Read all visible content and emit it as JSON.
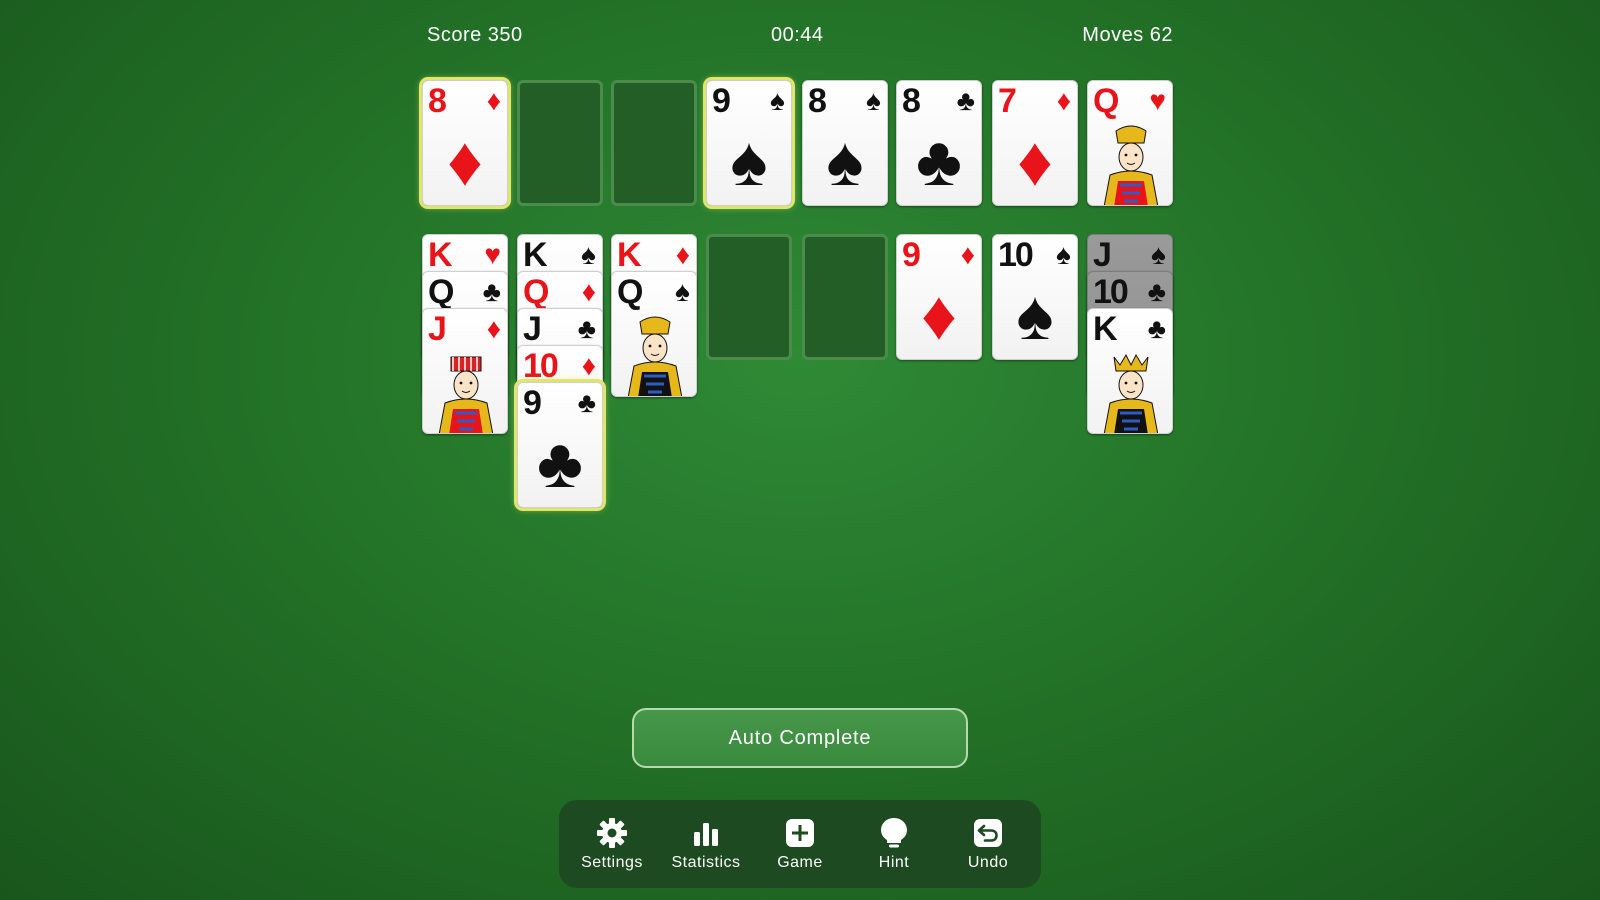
{
  "hud": {
    "score": "Score  350",
    "time": "00:44",
    "moves": "Moves  62"
  },
  "colors": {
    "felt": "#237328",
    "red_suit": "#e8141a",
    "black_suit": "#111111",
    "highlight": "#e1e66a"
  },
  "top_row": [
    {
      "rank": "8",
      "suit": "♦",
      "color": "red",
      "selected": true
    },
    {
      "empty": true
    },
    {
      "empty": true
    },
    {
      "rank": "9",
      "suit": "♠",
      "color": "black",
      "selected": true
    },
    {
      "rank": "8",
      "suit": "♠",
      "color": "black"
    },
    {
      "rank": "8",
      "suit": "♣",
      "color": "black"
    },
    {
      "rank": "7",
      "suit": "♦",
      "color": "red"
    },
    {
      "rank": "Q",
      "suit": "♥",
      "color": "red",
      "face": "queen"
    }
  ],
  "tableau": [
    [
      {
        "rank": "K",
        "suit": "♥",
        "color": "red"
      },
      {
        "rank": "Q",
        "suit": "♣",
        "color": "black"
      },
      {
        "rank": "J",
        "suit": "♦",
        "color": "red",
        "face": "jack"
      }
    ],
    [
      {
        "rank": "K",
        "suit": "♠",
        "color": "black"
      },
      {
        "rank": "Q",
        "suit": "♦",
        "color": "red"
      },
      {
        "rank": "J",
        "suit": "♣",
        "color": "black"
      },
      {
        "rank": "10",
        "suit": "♦",
        "color": "red"
      },
      {
        "rank": "9",
        "suit": "♣",
        "color": "black",
        "selected": true
      }
    ],
    [
      {
        "rank": "K",
        "suit": "♦",
        "color": "red"
      },
      {
        "rank": "Q",
        "suit": "♠",
        "color": "black",
        "face": "queen"
      }
    ],
    [],
    [],
    [
      {
        "rank": "9",
        "suit": "♦",
        "color": "red"
      }
    ],
    [
      {
        "rank": "10",
        "suit": "♠",
        "color": "black"
      }
    ],
    [
      {
        "rank": "J",
        "suit": "♠",
        "color": "black",
        "dim": true
      },
      {
        "rank": "10",
        "suit": "♣",
        "color": "black",
        "dim": true
      },
      {
        "rank": "K",
        "suit": "♣",
        "color": "black",
        "face": "king"
      }
    ]
  ],
  "auto_complete_label": "Auto Complete",
  "toolbar": [
    {
      "label": "Settings",
      "icon": "gear-icon"
    },
    {
      "label": "Statistics",
      "icon": "bar-chart-icon"
    },
    {
      "label": "Game",
      "icon": "plus-icon"
    },
    {
      "label": "Hint",
      "icon": "lightbulb-icon"
    },
    {
      "label": "Undo",
      "icon": "undo-icon"
    }
  ]
}
